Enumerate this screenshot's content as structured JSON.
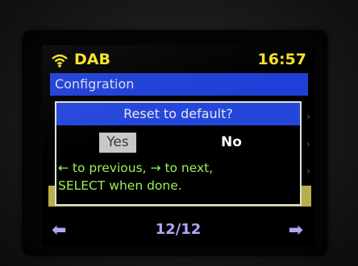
{
  "status": {
    "source": "DAB",
    "time": "16:57",
    "wifi_icon": "wifi-icon"
  },
  "menu": {
    "title": "Configration"
  },
  "dialog": {
    "title": "Reset to default?",
    "yes_label": "Yes",
    "no_label": "No",
    "hint_line1": "← to previous, → to next,",
    "hint_line2": "SELECT when done."
  },
  "footer": {
    "page": "12/12",
    "left_icon": "arrow-left-icon",
    "right_icon": "arrow-right-icon"
  },
  "colors": {
    "status_text": "#f3e226",
    "menu_bar": "#1f3fd6",
    "dialog_title_bar": "#2446d9",
    "hint_text": "#9cf05a",
    "footer_text": "#b2a6f5",
    "selected_button": "#c8c8c8"
  }
}
